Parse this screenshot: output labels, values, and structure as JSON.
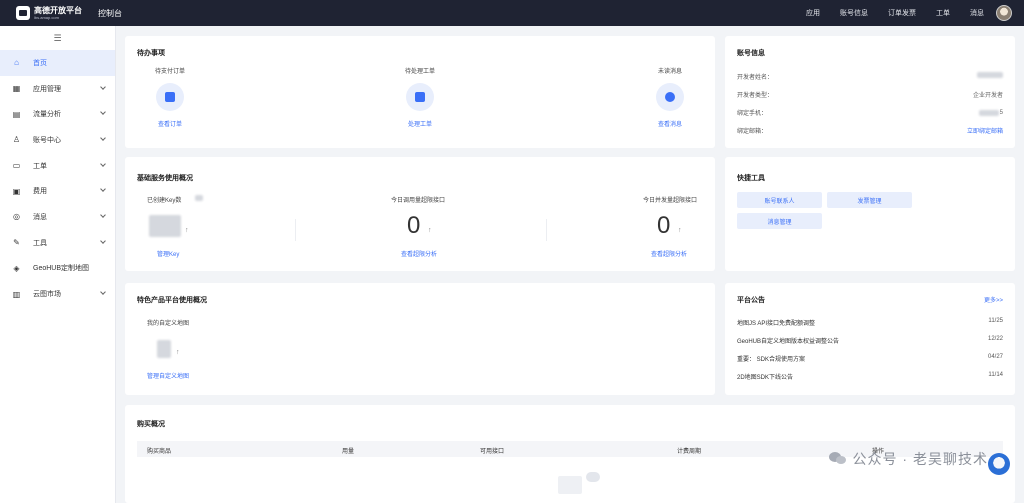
{
  "topbar": {
    "logo_main": "高德开放平台",
    "logo_sub": "lbs.amap.com",
    "console": "控制台",
    "nav": [
      "应用",
      "账号信息",
      "订单发票",
      "工单",
      "消息"
    ]
  },
  "sidebar": {
    "items": [
      {
        "label": "首页",
        "icon": "home-icon",
        "glyph": "⌂",
        "active": true,
        "has_children": false
      },
      {
        "label": "应用管理",
        "icon": "grid-icon",
        "glyph": "▦",
        "active": false,
        "has_children": true
      },
      {
        "label": "流量分析",
        "icon": "chart-icon",
        "glyph": "▤",
        "active": false,
        "has_children": true
      },
      {
        "label": "账号中心",
        "icon": "user-icon",
        "glyph": "♙",
        "active": false,
        "has_children": true
      },
      {
        "label": "工单",
        "icon": "ticket-icon",
        "glyph": "▭",
        "active": false,
        "has_children": true
      },
      {
        "label": "费用",
        "icon": "fee-icon",
        "glyph": "▣",
        "active": false,
        "has_children": true
      },
      {
        "label": "消息",
        "icon": "message-icon",
        "glyph": "◎",
        "active": false,
        "has_children": true
      },
      {
        "label": "工具",
        "icon": "wrench-icon",
        "glyph": "✎",
        "active": false,
        "has_children": true
      },
      {
        "label": "GeoHUB定制地图",
        "icon": "layers-icon",
        "glyph": "◈",
        "active": false,
        "has_children": false
      },
      {
        "label": "云图市场",
        "icon": "database-icon",
        "glyph": "▥",
        "active": false,
        "has_children": true
      }
    ]
  },
  "todo": {
    "title": "待办事项",
    "columns": [
      {
        "label": "待支付订单",
        "link": "查看订单",
        "icon": "wallet-icon"
      },
      {
        "label": "待处理工单",
        "link": "处理工单",
        "icon": "clipboard-icon"
      },
      {
        "label": "未读消息",
        "link": "查看消息",
        "icon": "chat-icon"
      }
    ]
  },
  "account": {
    "title": "账号信息",
    "rows": [
      {
        "label": "开发者姓名：",
        "value": ""
      },
      {
        "label": "开发者类型：",
        "value": "企业开发者"
      },
      {
        "label": "绑定手机：",
        "value": "5"
      },
      {
        "label": "绑定邮箱：",
        "value": "立即绑定邮箱"
      }
    ]
  },
  "service": {
    "title": "基础服务使用概况",
    "cols": [
      {
        "label": "已创建Key数",
        "value": "",
        "link": "管理Key"
      },
      {
        "label": "今日调用量超限接口",
        "value": "0",
        "link": "查看超限分析"
      },
      {
        "label": "今日并发量超限接口",
        "value": "0",
        "link": "查看超限分析"
      }
    ],
    "arrow": "↑"
  },
  "tools": {
    "title": "快捷工具",
    "buttons": [
      "账号联系人",
      "发票管理",
      "消息管理"
    ]
  },
  "special": {
    "title": "特色产品平台使用概况",
    "label": "我的自定义地图",
    "link": "管理自定义地图"
  },
  "notice": {
    "title": "平台公告",
    "more": "更多>>",
    "items": [
      {
        "text": "地图JS API接口免费配额调整",
        "date": "11/25"
      },
      {
        "text": "GeoHUB自定义地图版本权益调整公告",
        "date": "12/22"
      },
      {
        "text": "重要：  SDK合规使用方案",
        "date": "04/27"
      },
      {
        "text": "2D地图SDK下线公告",
        "date": "11/14"
      }
    ]
  },
  "purchase": {
    "title": "购买概况",
    "columns": [
      "购买商品",
      "用量",
      "可用接口",
      "计费周期",
      "操作"
    ]
  },
  "watermark": {
    "text": "公众号 · 老吴聊技术"
  }
}
